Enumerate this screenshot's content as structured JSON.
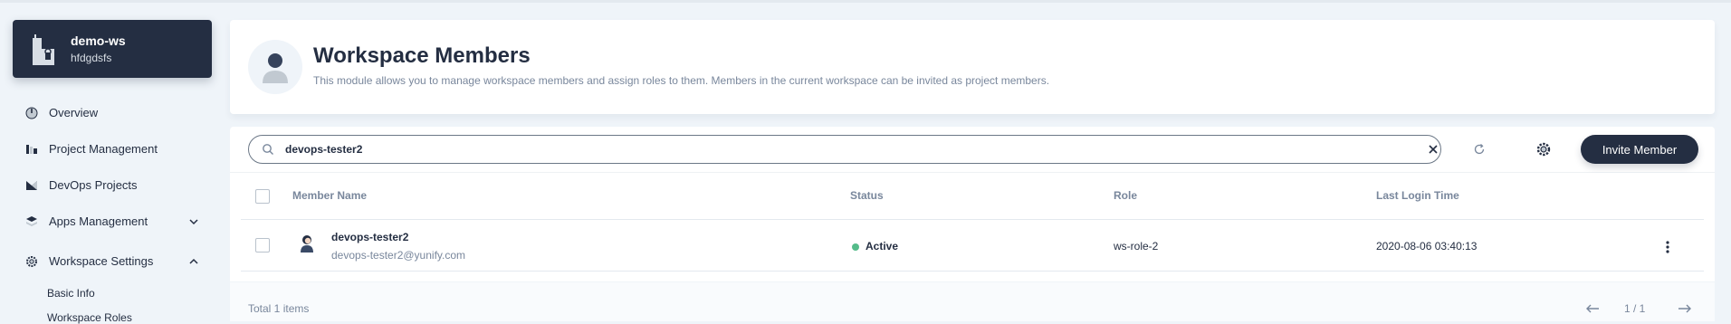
{
  "workspace": {
    "name": "demo-ws",
    "description": "hfdgdsfs",
    "icon": "workspace-building-icon"
  },
  "sidebar": {
    "items": [
      {
        "label": "Overview",
        "icon": "dashboard-icon"
      },
      {
        "label": "Project Management",
        "icon": "project-icon"
      },
      {
        "label": "DevOps Projects",
        "icon": "devops-icon"
      },
      {
        "label": "Apps Management",
        "icon": "apps-icon",
        "expandable": true,
        "expanded": false
      },
      {
        "label": "Workspace Settings",
        "icon": "gear-icon",
        "expandable": true,
        "expanded": true
      }
    ],
    "sub_items": [
      {
        "label": "Basic Info"
      },
      {
        "label": "Workspace Roles"
      }
    ]
  },
  "header": {
    "title": "Workspace Members",
    "description": "This module allows you to manage workspace members and assign roles to them. Members in the current workspace can be invited as project members.",
    "icon": "member-avatar-icon"
  },
  "toolbar": {
    "search_value": "devops-tester2",
    "invite_label": "Invite Member"
  },
  "table": {
    "columns": [
      "Member Name",
      "Status",
      "Role",
      "Last Login Time"
    ],
    "rows": [
      {
        "name": "devops-tester2",
        "email": "devops-tester2@yunify.com",
        "status": "Active",
        "role": "ws-role-2",
        "last_login": "2020-08-06 03:40:13"
      }
    ]
  },
  "footer": {
    "total": "Total 1 items",
    "page": "1 / 1"
  },
  "colors": {
    "background": "#eff4f9",
    "dark": "#242e42",
    "muted": "#79879c",
    "active_green": "#55bc8a"
  }
}
